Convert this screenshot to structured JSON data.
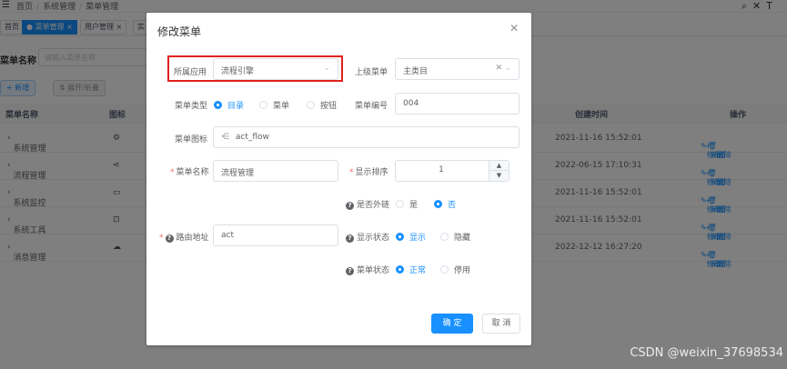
{
  "background": {
    "breadcrumb": [
      "首页",
      "系统管理",
      "菜单管理"
    ],
    "tags": [
      "首页",
      "菜单管理",
      "用户管理",
      "实"
    ],
    "search": {
      "label": "菜单名称",
      "placeholder": "请输入菜单名称"
    },
    "buttons": {
      "add": "+ 新增",
      "expand": "⇅ 展开/折叠"
    },
    "table": {
      "headers": [
        "菜单名称",
        "图标",
        "创建时间",
        "操作"
      ],
      "rows": [
        {
          "name": "系统管理",
          "icon": "gear-icon",
          "time": "2021-11-16 15:52:01"
        },
        {
          "name": "流程管理",
          "icon": "share-icon",
          "time": "2022-06-15 17:10:31"
        },
        {
          "name": "系统监控",
          "icon": "monitor-icon",
          "time": "2021-11-16 15:52:01"
        },
        {
          "name": "系统工具",
          "icon": "toolbox-icon",
          "time": "2021-11-16 15:52:01"
        },
        {
          "name": "消息管理",
          "icon": "wechat-icon",
          "time": "2022-12-12 16:27:20"
        }
      ],
      "ops": [
        "修改",
        "新增",
        "删除"
      ]
    }
  },
  "dialog": {
    "title": "修改菜单",
    "app_label": "所属应用",
    "app_value": "流程引擎",
    "parent_label": "上级菜单",
    "parent_value": "主类目",
    "type_label": "菜单类型",
    "type_options": [
      "目录",
      "菜单",
      "按钮"
    ],
    "type_selected": "目录",
    "code_label": "菜单编号",
    "code_value": "004",
    "icon_label": "菜单图标",
    "icon_value": "act_flow",
    "name_label": "菜单名称",
    "name_value": "流程管理",
    "sort_label": "显示排序",
    "sort_value": "1",
    "external_label": "是否外链",
    "external_options": [
      "是",
      "否"
    ],
    "external_selected": "否",
    "path_label": "路由地址",
    "path_value": "act",
    "visible_label": "显示状态",
    "visible_options": [
      "显示",
      "隐藏"
    ],
    "visible_selected": "显示",
    "status_label": "菜单状态",
    "status_options": [
      "正常",
      "停用"
    ],
    "status_selected": "正常",
    "ok": "确 定",
    "cancel": "取 消"
  },
  "watermark": "CSDN @weixin_37698534",
  "colors": {
    "primary": "#1890ff",
    "highlight": "#e02020",
    "required": "#f56c6c"
  }
}
